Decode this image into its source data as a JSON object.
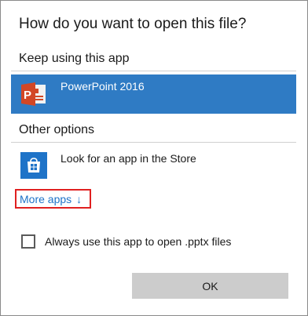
{
  "dialog": {
    "title": "How do you want to open this file?"
  },
  "keep_section": {
    "label": "Keep using this app",
    "app": {
      "name": "PowerPoint 2016",
      "icon": "powerpoint-icon",
      "selected": true
    }
  },
  "other_section": {
    "label": "Other options",
    "store": {
      "name": "Look for an app in the Store",
      "icon": "store-icon"
    }
  },
  "more_apps": {
    "label": "More apps",
    "arrow": "↓"
  },
  "always_use": {
    "label": "Always use this app to open .pptx files",
    "checked": false
  },
  "ok_button": {
    "label": "OK"
  },
  "colors": {
    "selection": "#2f7bc4",
    "powerpoint": "#d24726",
    "store": "#1e73c8",
    "link": "#1e73c8",
    "highlight_box": "#e02020",
    "button": "#cccccc"
  }
}
